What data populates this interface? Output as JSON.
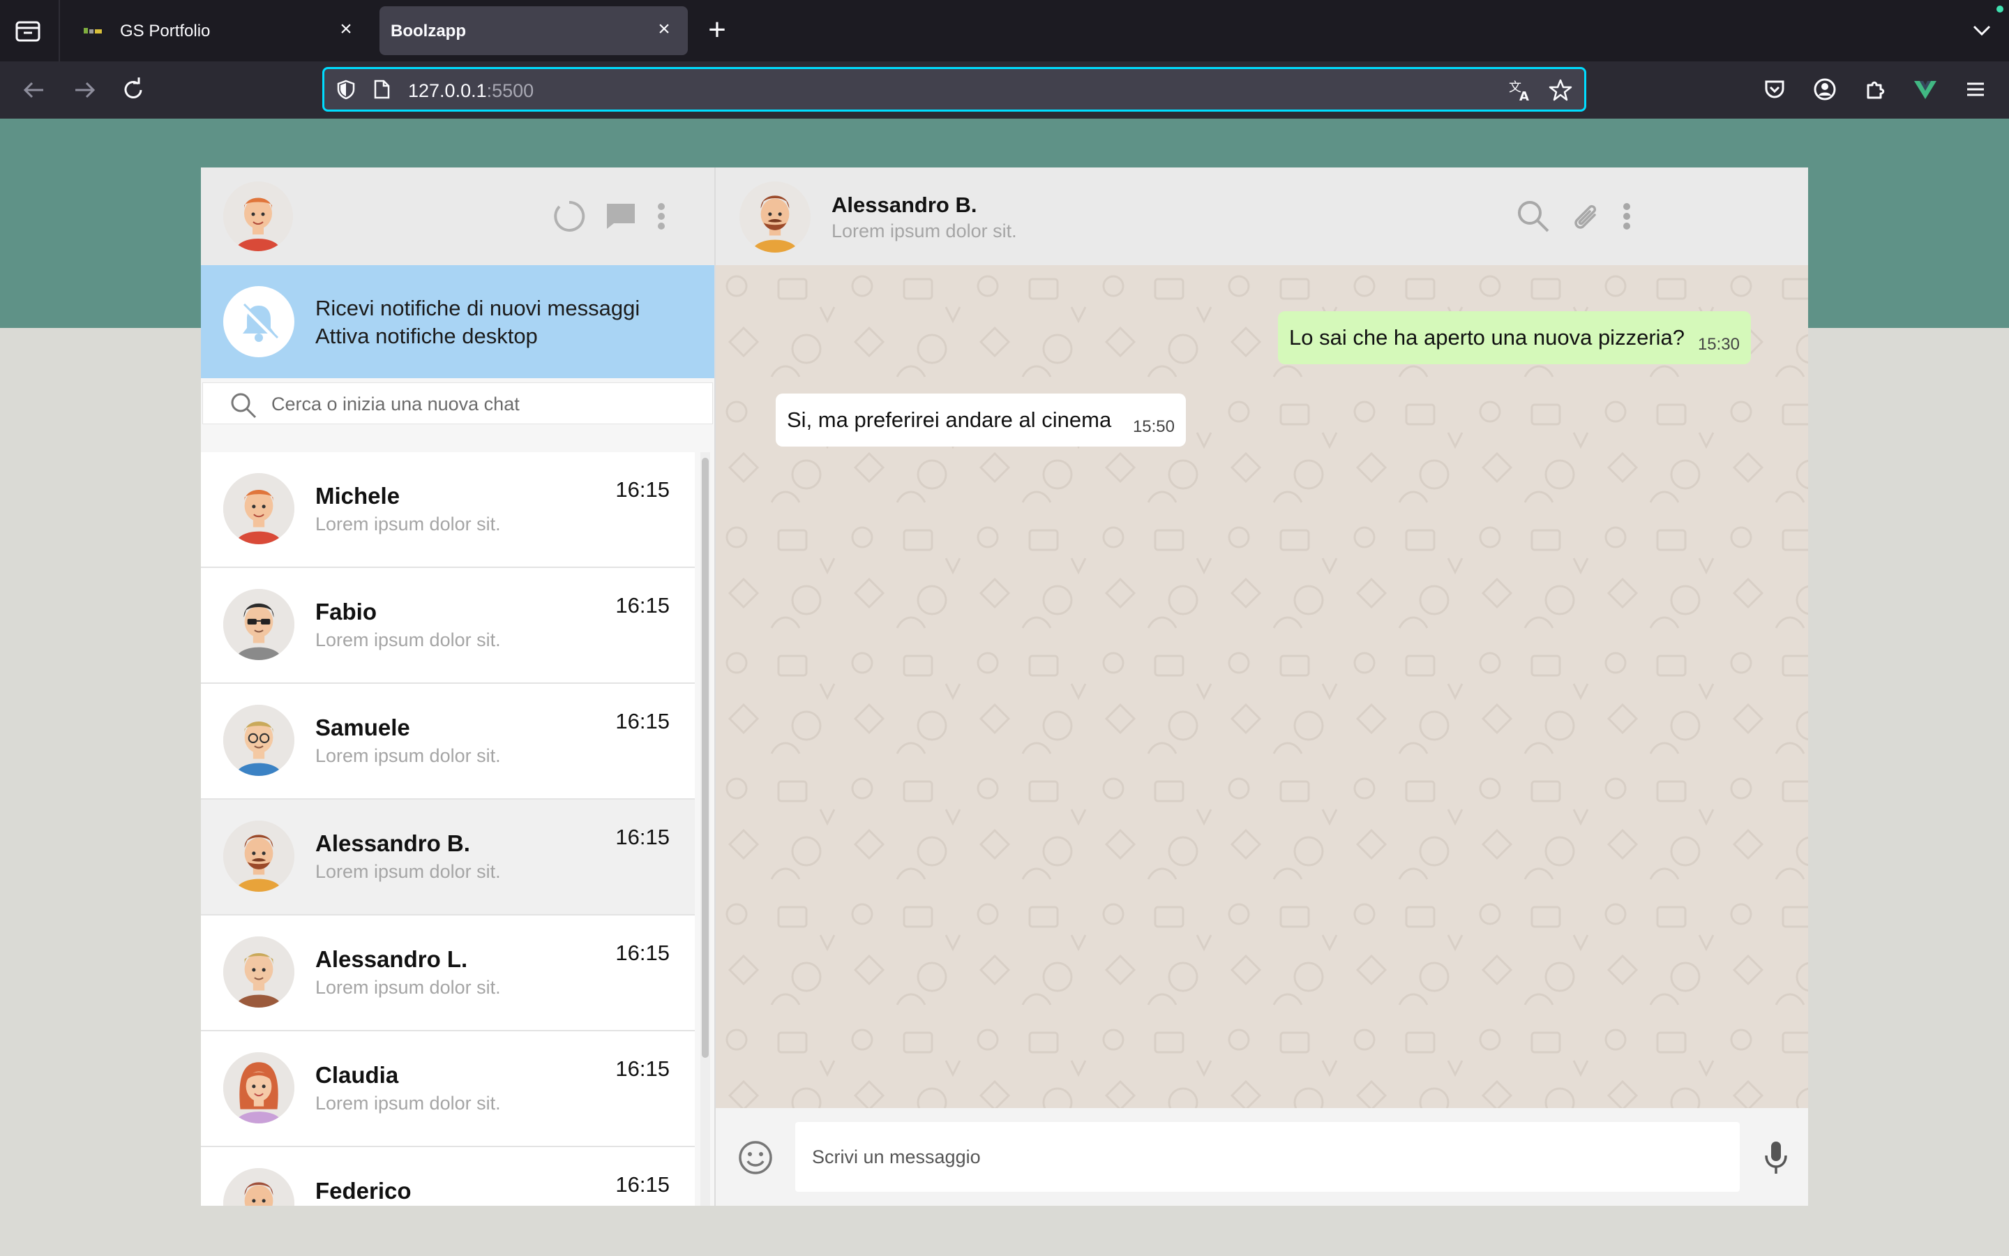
{
  "browser": {
    "tabs": [
      {
        "title": "GS Portfolio",
        "active": false
      },
      {
        "title": "Boolzapp",
        "active": true
      }
    ],
    "url_host": "127.0.0.1",
    "url_port": ":5500"
  },
  "colors": {
    "band": "#5f9287",
    "notification_bg": "#a9d4f4",
    "sent_bubble": "#d5f9ba",
    "chat_bg": "#e5ddd5"
  },
  "notification": {
    "title": "Ricevi notifiche di nuovi messaggi",
    "link": "Attiva notifiche desktop"
  },
  "search": {
    "placeholder": "Cerca o inizia una nuova chat"
  },
  "contacts": [
    {
      "name": "Michele",
      "preview": "Lorem ipsum dolor sit.",
      "time": "16:15",
      "active": false
    },
    {
      "name": "Fabio",
      "preview": "Lorem ipsum dolor sit.",
      "time": "16:15",
      "active": false
    },
    {
      "name": "Samuele",
      "preview": "Lorem ipsum dolor sit.",
      "time": "16:15",
      "active": false
    },
    {
      "name": "Alessandro B.",
      "preview": "Lorem ipsum dolor sit.",
      "time": "16:15",
      "active": true
    },
    {
      "name": "Alessandro L.",
      "preview": "Lorem ipsum dolor sit.",
      "time": "16:15",
      "active": false
    },
    {
      "name": "Claudia",
      "preview": "Lorem ipsum dolor sit.",
      "time": "16:15",
      "active": false
    },
    {
      "name": "Federico",
      "preview": "",
      "time": "16:15",
      "active": false
    }
  ],
  "conversation": {
    "name": "Alessandro B.",
    "status": "Lorem ipsum dolor sit.",
    "messages": [
      {
        "text": "Lo sai che ha aperto una nuova pizzeria?",
        "time": "15:30",
        "type": "sent"
      },
      {
        "text": "Si, ma preferirei andare al cinema",
        "time": "15:50",
        "type": "received"
      }
    ]
  },
  "composer": {
    "placeholder": "Scrivi un messaggio"
  }
}
